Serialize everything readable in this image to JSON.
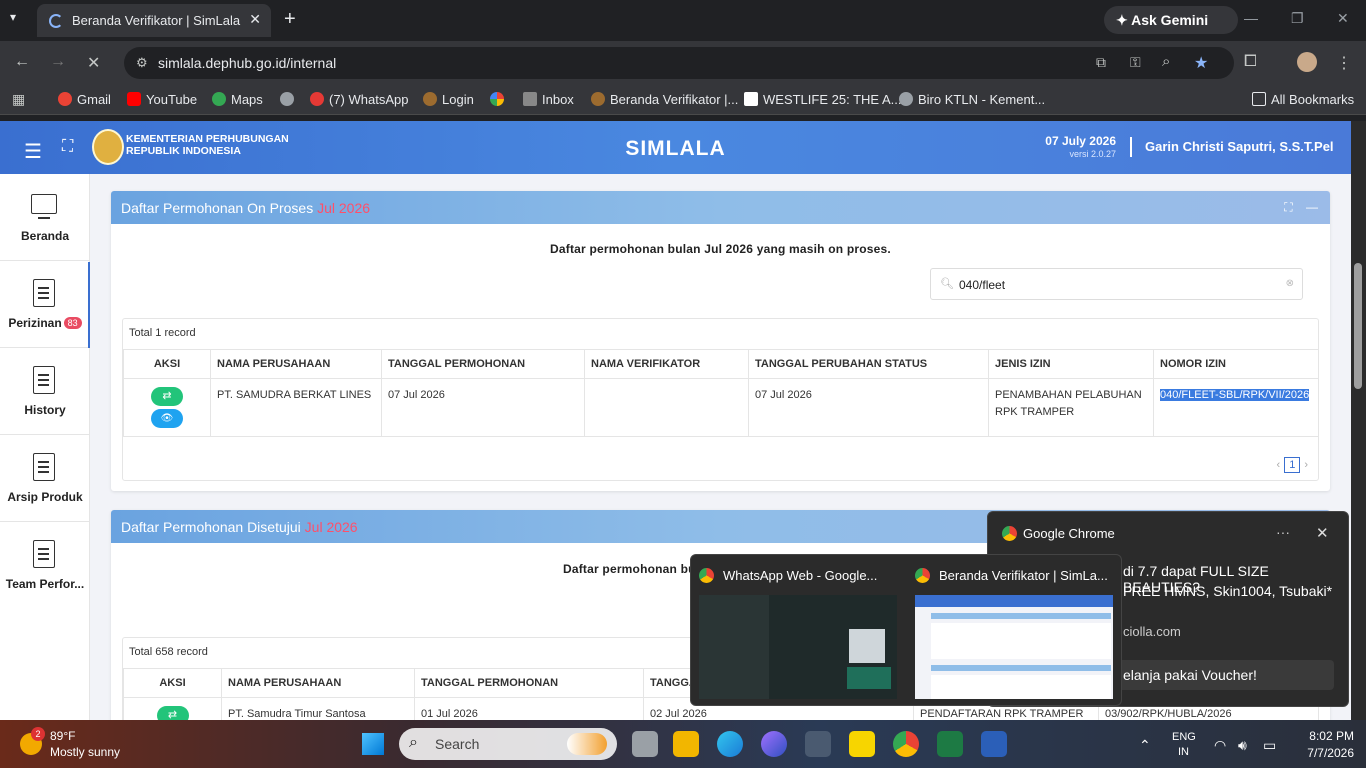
{
  "browser": {
    "tab_title": "Beranda Verifikator | SimLala",
    "url": "simlala.dephub.go.id/internal",
    "ask_gemini": "Ask Gemini",
    "bookmarks": [
      {
        "label": "Gmail",
        "color": "#ea4335"
      },
      {
        "label": "YouTube",
        "color": "#ff0000"
      },
      {
        "label": "Maps",
        "color": "#34a853"
      },
      {
        "label": "",
        "color": "#9aa0a6"
      },
      {
        "label": "(7) WhatsApp",
        "color": "#e53935"
      },
      {
        "label": "Login",
        "color": "#9c6b2f"
      },
      {
        "label": "",
        "color": "#fbbc04"
      },
      {
        "label": "Inbox",
        "color": "#888"
      },
      {
        "label": "Beranda Verifikator |...",
        "color": "#9c6b2f"
      },
      {
        "label": "WESTLIFE 25: THE A...",
        "color": "#ffffff"
      },
      {
        "label": "Biro KTLN - Kement...",
        "color": "#9aa0a6"
      }
    ],
    "all_bookmarks": "All Bookmarks"
  },
  "header": {
    "ministry_line1": "KEMENTERIAN PERHUBUNGAN",
    "ministry_line2": "REPUBLIK INDONESIA",
    "title": "SIMLALA",
    "date": "07 July 2026",
    "version": "versi 2.0.27",
    "user": "Garin Christi Saputri, S.S.T.Pel"
  },
  "sidebar": {
    "items": [
      {
        "label": "Beranda"
      },
      {
        "label": "Perizinan",
        "badge": "83"
      },
      {
        "label": "History"
      },
      {
        "label": "Arsip Produk"
      },
      {
        "label": "Team Perfor..."
      }
    ]
  },
  "card1": {
    "title": "Daftar Permohonan On Proses ",
    "period": "Jul 2026",
    "subtitle": "Daftar permohonan bulan Jul 2026 yang masih on proses.",
    "search_value": "040/fleet",
    "total": "Total 1 record",
    "columns": [
      "AKSI",
      "NAMA PERUSAHAAN",
      "TANGGAL PERMOHONAN",
      "NAMA VERIFIKATOR",
      "TANGGAL PERUBAHAN STATUS",
      "JENIS IZIN",
      "NOMOR IZIN"
    ],
    "row": {
      "company": "PT. SAMUDRA BERKAT LINES",
      "date_request": "07 Jul 2026",
      "verifier": "",
      "date_status": "07 Jul 2026",
      "permit_type_1": "PENAMBAHAN PELABUHAN",
      "permit_type_2": "RPK TRAMPER",
      "permit_number": "040/FLEET-SBL/RPK/VII/2026"
    },
    "page": "1"
  },
  "card2": {
    "title": "Daftar Permohonan Disetujui ",
    "period": "Jul 2026",
    "subtitle": "Daftar permohonan bu",
    "total": "Total 658 record",
    "columns": [
      "AKSI",
      "NAMA PERUSAHAAN",
      "TANGGAL PERMOHONAN",
      "TANGGA"
    ],
    "row": {
      "company": "PT. Samudra Timur Santosa",
      "date_request": "01 Jul 2026",
      "date_status": "02 Jul 2026",
      "permit_type": "PENDAFTARAN RPK TRAMPER",
      "permit_number": "03/902/RPK/HUBLA/2026"
    }
  },
  "thumbnails": [
    {
      "title": "WhatsApp Web - Google..."
    },
    {
      "title": "Beranda Verifikator | SimLa..."
    }
  ],
  "notification": {
    "app": "Google Chrome",
    "line1": "di 7.7 dapat FULL SIZE BEAUTIES?",
    "line2": "FREE HMNS, Skin1004, Tsubaki*",
    "line3": "ciolla.com",
    "button": "elanja pakai Voucher!"
  },
  "taskbar": {
    "weather_badge": "2",
    "temp": "89°F",
    "weather": "Mostly sunny",
    "search": "Search",
    "lang1": "ENG",
    "lang2": "IN",
    "time": "8:02 PM",
    "date": "7/7/2026"
  }
}
